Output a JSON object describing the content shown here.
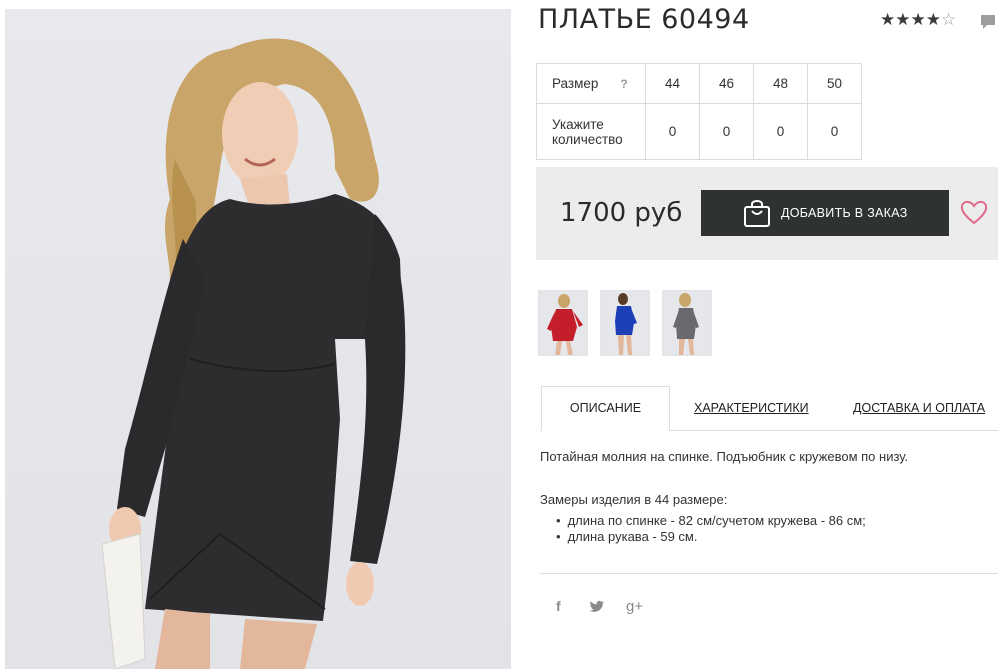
{
  "product": {
    "title": "ПЛАТЬЕ 60494",
    "rating": {
      "value": 4,
      "max": 5
    },
    "image": "woman-in-black-long-sleeve-dress-photo"
  },
  "size_table": {
    "size_label": "Размер",
    "help_mark": "?",
    "quantity_label_line1": "Укажите",
    "quantity_label_line2": "количество",
    "sizes": [
      "44",
      "46",
      "48",
      "50"
    ],
    "quantities": [
      "0",
      "0",
      "0",
      "0"
    ]
  },
  "order": {
    "price": "1700 руб",
    "add_button_label": "ДОБАВИТЬ В ЗАКАЗ",
    "button_color": "#2f3233",
    "heart_color": "#e26b8c"
  },
  "thumbnails": [
    {
      "name": "red-dress-thumbnail",
      "color": "#c41e2a"
    },
    {
      "name": "blue-dress-thumbnail",
      "color": "#1c3fb8"
    },
    {
      "name": "grey-dress-thumbnail",
      "color": "#6a6a6e"
    }
  ],
  "tabs": [
    {
      "label": "ОПИСАНИЕ",
      "active": true
    },
    {
      "label": "ХАРАКТЕРИСТИКИ",
      "active": false
    },
    {
      "label": "ДОСТАВКА И ОПЛАТА",
      "active": false
    }
  ],
  "description": {
    "text": "Потайная молния на спинке. Подъюбник с кружевом по низу.",
    "measures_title": "Замеры изделия в 44 размере:",
    "measures": [
      "длина по спинке - 82 см/сучетом кружева - 86 см;",
      "длина рукава - 59 см."
    ]
  },
  "social": {
    "facebook": "f",
    "twitter": "twitter-bird-icon",
    "google_plus": "g+"
  }
}
